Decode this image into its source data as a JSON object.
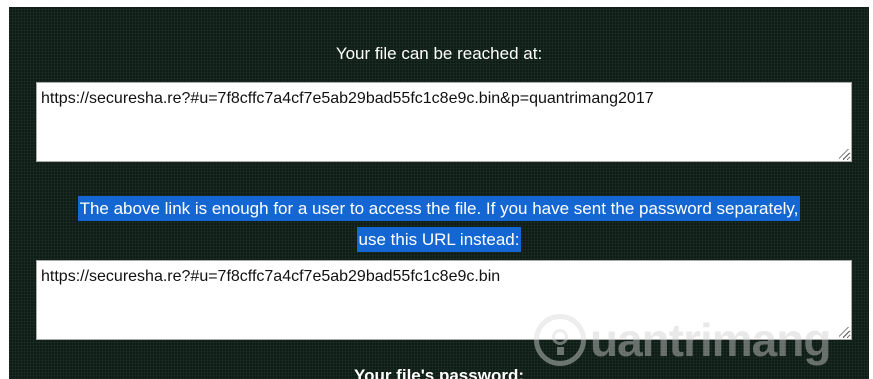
{
  "reach_heading": "Your file can be reached at:",
  "full_url": "https://securesha.re?#u=7f8cffc7a4cf7e5ab29bad55fc1c8e9c.bin&p=quantrimang2017",
  "notice_line1": "The above link is enough for a user to access the file. If you have sent the password separately,",
  "notice_line2": "use this URL instead:",
  "short_url": "https://securesha.re?#u=7f8cffc7a4cf7e5ab29bad55fc1c8e9c.bin",
  "password_heading": "Your file's password:",
  "watermark": "uantrimang",
  "icons": {
    "resize": "resize-grip-icon",
    "logo": "lightbulb-logo-icon"
  },
  "colors": {
    "panel_bg": "#0f1d17",
    "highlight": "#1467d2",
    "text": "#ffffff"
  }
}
